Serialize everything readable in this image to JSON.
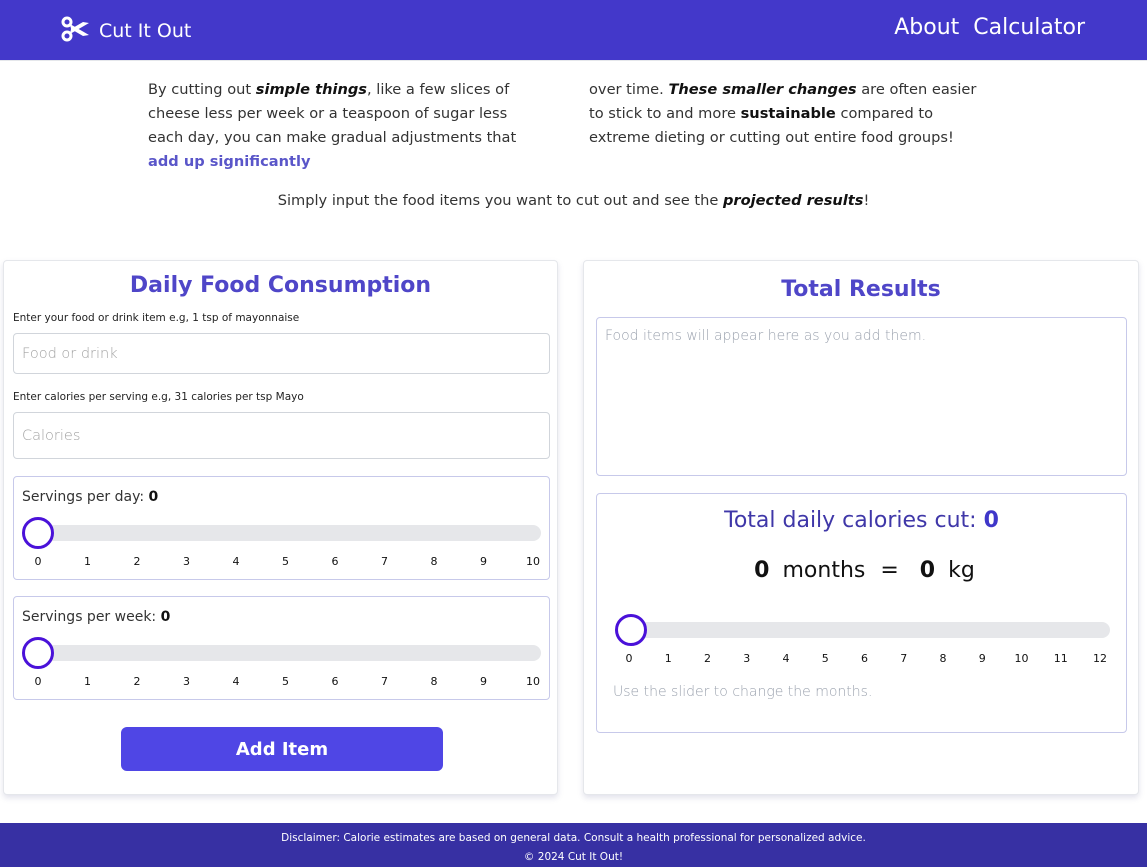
{
  "nav": {
    "brand": "Cut It Out",
    "brand_icon": "scissors-icon",
    "links": [
      {
        "label": "About"
      },
      {
        "label": "Calculator"
      }
    ]
  },
  "intro": {
    "left": {
      "t1": "By cutting out ",
      "b1": "simple things",
      "t2": ", like a few slices of cheese less per week or a teaspoon of sugar less each day, you can make gradual adjustments that ",
      "accent": "add up significantly"
    },
    "right": {
      "t1": "over time. ",
      "b1": "These smaller changes",
      "t2": " are often easier to stick to and more ",
      "b2": "sustainable",
      "t3": " compared to extreme dieting or cutting out entire food groups!"
    }
  },
  "cta": {
    "t1": "Simply input the food items you want to cut out and see the ",
    "b1": "projected results",
    "t2": "!"
  },
  "food_form": {
    "title": "Daily Food Consumption",
    "food_label": "Enter your food or drink item e.g, 1 tsp of mayonnaise",
    "food_placeholder": "Food or drink",
    "food_value": "",
    "calories_label": "Enter calories per serving e.g, 31 calories per tsp Mayo",
    "calories_placeholder": "Calories",
    "calories_value": "",
    "servings_day": {
      "label": "Servings per day: ",
      "value": "0",
      "min": 0,
      "max": 10,
      "ticks": [
        "0",
        "1",
        "2",
        "3",
        "4",
        "5",
        "6",
        "7",
        "8",
        "9",
        "10"
      ]
    },
    "servings_week": {
      "label": "Servings per week: ",
      "value": "0",
      "min": 0,
      "max": 10,
      "ticks": [
        "0",
        "1",
        "2",
        "3",
        "4",
        "5",
        "6",
        "7",
        "8",
        "9",
        "10"
      ]
    },
    "add_button": "Add Item"
  },
  "results": {
    "title": "Total Results",
    "empty_text": "Food items will appear here as you add them.",
    "total_label": "Total daily calories cut: ",
    "total_value": "0",
    "months_value": "0",
    "months_label": "months",
    "equals": "=",
    "kg_value": "0",
    "kg_label": "kg",
    "months_slider": {
      "value": 0,
      "min": 0,
      "max": 12,
      "ticks": [
        "0",
        "1",
        "2",
        "3",
        "4",
        "5",
        "6",
        "7",
        "8",
        "9",
        "10",
        "11",
        "12"
      ]
    },
    "hint": "Use the slider to change the months."
  },
  "footer": {
    "disclaimer": "Disclaimer: Calorie estimates are based on general data. Consult a health professional for personalized advice.",
    "copyright": "© 2024 Cut It Out!"
  },
  "colors": {
    "primary": "#4338ca",
    "button": "#4f46e5",
    "footer": "#3730a3",
    "slider_thumb": "#4a11d9"
  }
}
